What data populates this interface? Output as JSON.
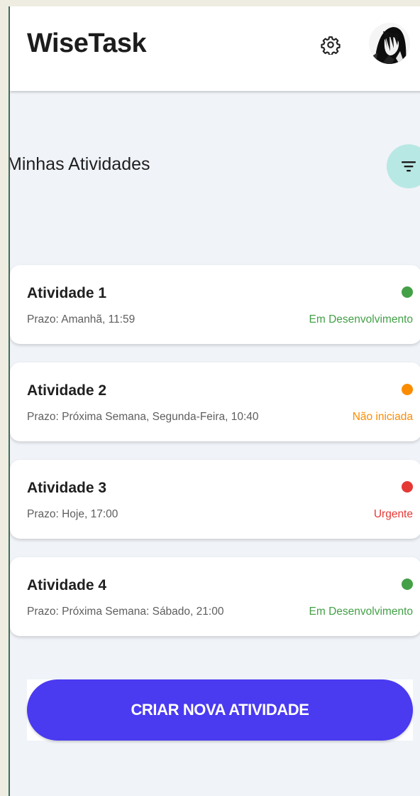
{
  "header": {
    "title": "WiseTask",
    "settings_icon": "gear-icon",
    "avatar_icon": "user-avatar"
  },
  "section": {
    "title": "Minhas Atividades",
    "filter_icon": "filter-icon"
  },
  "tasks": [
    {
      "title": "Atividade 1",
      "deadline": "Prazo: Amanhã, 11:59",
      "status": "Em Desenvolvimento",
      "color": "#43a047"
    },
    {
      "title": "Atividade 2",
      "deadline": "Prazo: Próxima Semana, Segunda-Feira, 10:40",
      "status": "Não iniciada",
      "color": "#fb8c00"
    },
    {
      "title": "Atividade 3",
      "deadline": "Prazo: Hoje, 17:00",
      "status": "Urgente",
      "color": "#e53935"
    },
    {
      "title": "Atividade 4",
      "deadline": "Prazo: Próxima Semana: Sábado, 21:00",
      "status": "Em Desenvolvimento",
      "color": "#43a047"
    }
  ],
  "actions": {
    "create_label": "CRIAR NOVA ATIVIDADE"
  },
  "colors": {
    "accent": "#4a3af0",
    "filter_bg": "#b8e8e4",
    "app_bg": "#f0f3f8"
  }
}
